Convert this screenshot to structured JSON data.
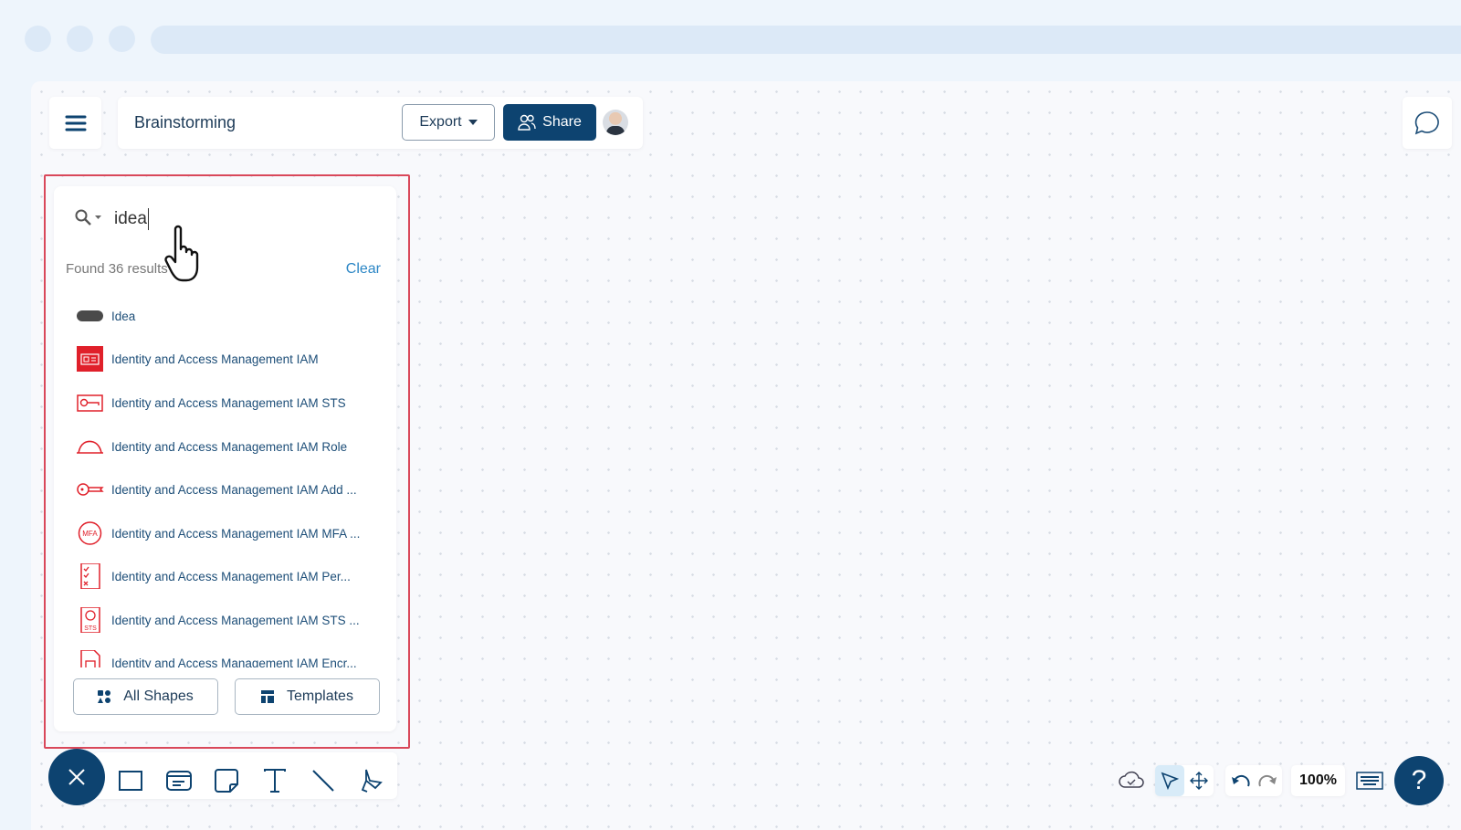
{
  "header": {
    "title": "Brainstorming",
    "export_label": "Export",
    "share_label": "Share"
  },
  "search": {
    "query": "idea",
    "results_text": "Found 36 results",
    "clear_label": "Clear"
  },
  "results": [
    {
      "label": "Idea",
      "icon": "pill-shape-icon"
    },
    {
      "label": "Identity and Access Management IAM",
      "icon": "iam-id-card-icon"
    },
    {
      "label": "Identity and Access Management IAM STS",
      "icon": "iam-sts-key-card-icon"
    },
    {
      "label": "Identity and Access Management IAM Role",
      "icon": "iam-role-hardhat-icon"
    },
    {
      "label": "Identity and Access Management IAM Add ...",
      "icon": "iam-key-icon"
    },
    {
      "label": "Identity and Access Management IAM MFA ...",
      "icon": "iam-mfa-icon"
    },
    {
      "label": "Identity and Access Management IAM Per...",
      "icon": "iam-permissions-checklist-icon"
    },
    {
      "label": "Identity and Access Management IAM STS ...",
      "icon": "iam-sts-document-icon"
    },
    {
      "label": "Identity and Access Management IAM Encr...",
      "icon": "iam-encrypted-document-icon"
    }
  ],
  "panel_buttons": {
    "all_shapes": "All Shapes",
    "templates": "Templates"
  },
  "status": {
    "zoom": "100%"
  },
  "colors": {
    "primary": "#0d4370",
    "accent_red": "#e0202a",
    "highlight_border": "#d9485a",
    "link": "#2b86c5"
  }
}
